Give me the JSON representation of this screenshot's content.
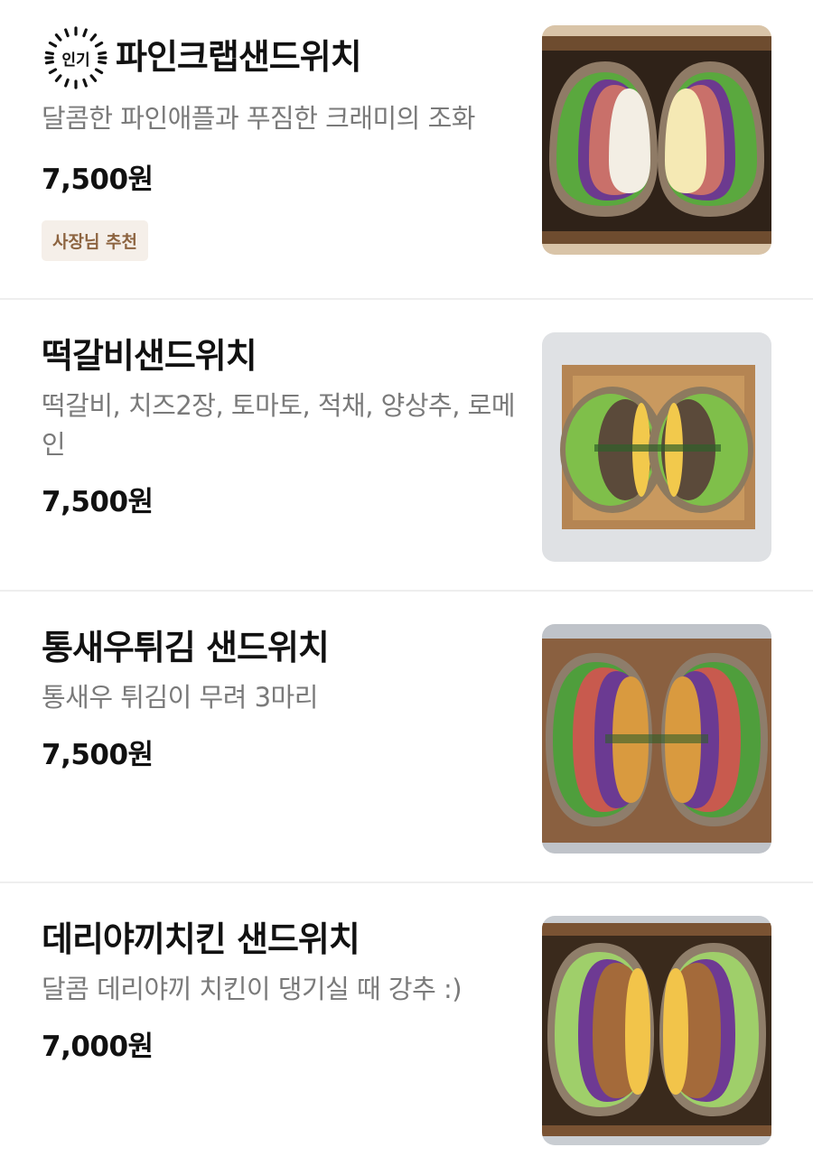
{
  "menu": {
    "items": [
      {
        "name": "파인크랩샌드위치",
        "description": "달콤한 파인애플과 푸짐한 크래미의 조화",
        "price": "7,500원",
        "popular_badge": "인기",
        "owner_badge": "사장님 추천",
        "image_icon": "sandwich-photo"
      },
      {
        "name": "떡갈비샌드위치",
        "description": "떡갈비, 치즈2장, 토마토, 적채, 양상추, 로메인",
        "price": "7,500원",
        "image_icon": "sandwich-photo"
      },
      {
        "name": "통새우튀김 샌드위치",
        "description": "통새우 튀김이 무려 3마리",
        "price": "7,500원",
        "image_icon": "sandwich-photo"
      },
      {
        "name": "데리야끼치킨 샌드위치",
        "description": "달콤 데리야끼 치킨이 댕기실 때 강추 :)",
        "price": "7,000원",
        "image_icon": "sandwich-photo"
      }
    ]
  },
  "colors": {
    "text_primary": "#111111",
    "text_secondary": "#7a7a7a",
    "owner_badge_bg": "#f5efe9",
    "owner_badge_text": "#8d6440",
    "divider": "#eeeeee"
  }
}
